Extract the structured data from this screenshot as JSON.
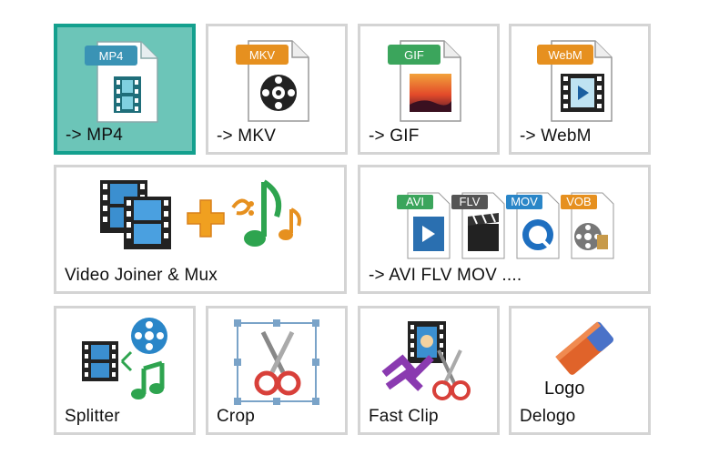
{
  "tiles": {
    "mp4": {
      "label": "-> MP4",
      "badge": "MP4",
      "selected": true
    },
    "mkv": {
      "label": "-> MKV",
      "badge": "MKV"
    },
    "gif": {
      "label": "-> GIF",
      "badge": "GIF"
    },
    "webm": {
      "label": "-> WebM",
      "badge": "WebM"
    },
    "joiner": {
      "label": "Video Joiner & Mux"
    },
    "multi": {
      "label": "-> AVI FLV MOV ....",
      "badges": [
        "AVI",
        "FLV",
        "MOV",
        "VOB"
      ]
    },
    "splitter": {
      "label": "Splitter"
    },
    "crop": {
      "label": "Crop"
    },
    "fastclip": {
      "label": "Fast Clip"
    },
    "delogo": {
      "label": "Delogo",
      "logo_text": "Logo"
    }
  },
  "colors": {
    "selected_bg": "#6cc5b8",
    "selected_border": "#14a08e",
    "tile_border": "#d4d4d4",
    "mp4_tag": "#3a93b5",
    "mkv_tag": "#e6901f",
    "gif_tag": "#3ba55c",
    "webm_tag": "#e6901f"
  },
  "icons": {
    "mp4": "file-film-icon",
    "mkv": "file-reel-icon",
    "gif": "file-image-icon",
    "webm": "file-play-icon",
    "joiner": "film-plus-music-icon",
    "multi": "multi-format-icon",
    "splitter": "film-split-icon",
    "crop": "scissors-crop-icon",
    "fastclip": "fast-clip-icon",
    "delogo": "eraser-icon"
  }
}
